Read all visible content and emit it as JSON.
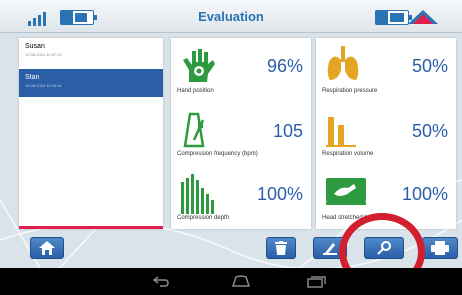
{
  "header": {
    "title": "Evaluation"
  },
  "users": [
    {
      "name": "Susan",
      "date": "12.06.2013 12:47:13",
      "selected": false
    },
    {
      "name": "Stan",
      "date": "12.06.2013 11:08:14",
      "selected": true
    }
  ],
  "metrics": {
    "hand_position": {
      "label": "Hand position",
      "value": "96%"
    },
    "compression_frequency": {
      "label": "Compression frequency (bpm)",
      "value": "105"
    },
    "compression_depth": {
      "label": "Compression depth",
      "value": "100%"
    },
    "respiration_pressure": {
      "label": "Respiration pressure",
      "value": "50%"
    },
    "respiration_volume": {
      "label": "Respiration volume",
      "value": "50%"
    },
    "head_stretched_back": {
      "label": "Head stretched back",
      "value": "100%"
    }
  },
  "icons": {
    "home": "home-icon",
    "delete": "trash-icon",
    "edit": "pencil-icon",
    "search": "magnifier-icon",
    "print": "printer-icon",
    "back": "back-icon",
    "nav_home": "nav-home-icon",
    "recents": "recents-icon"
  },
  "colors": {
    "accent": "#2a5fa8",
    "metric_icon": "#2e9a3f",
    "lung_icon": "#e4a522",
    "alert": "#d21f2f"
  }
}
